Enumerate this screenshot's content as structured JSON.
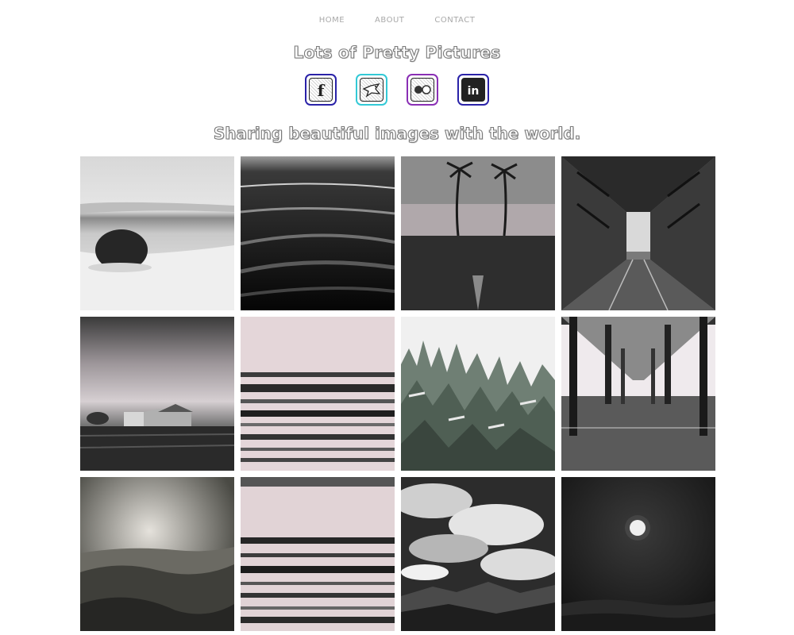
{
  "nav": {
    "items": [
      {
        "label": "HOME"
      },
      {
        "label": "ABOUT"
      },
      {
        "label": "CONTACT"
      }
    ]
  },
  "header": {
    "title": "Lots of Pretty Pictures",
    "tagline": "Sharing beautiful images with the world."
  },
  "social": [
    {
      "icon": "facebook-icon",
      "frame_color": "#2a22a8",
      "glyph": "f"
    },
    {
      "icon": "bird-icon",
      "frame_color": "#33c9d6"
    },
    {
      "icon": "flickr-icon",
      "frame_color": "#8a2fb5"
    },
    {
      "icon": "linkedin-icon",
      "frame_color": "#2a22a8",
      "glyph": "in"
    }
  ],
  "gallery": {
    "photos": [
      "ocean-rock",
      "dark-waves",
      "palm-trees-beach",
      "steel-bridge",
      "farmhouse-field",
      "pink-blurred-sea",
      "snowy-pine-forest",
      "pier-underside",
      "misty-hills",
      "pink-blurred-sea-2",
      "dramatic-clouds-mountains",
      "full-moon-night"
    ]
  }
}
